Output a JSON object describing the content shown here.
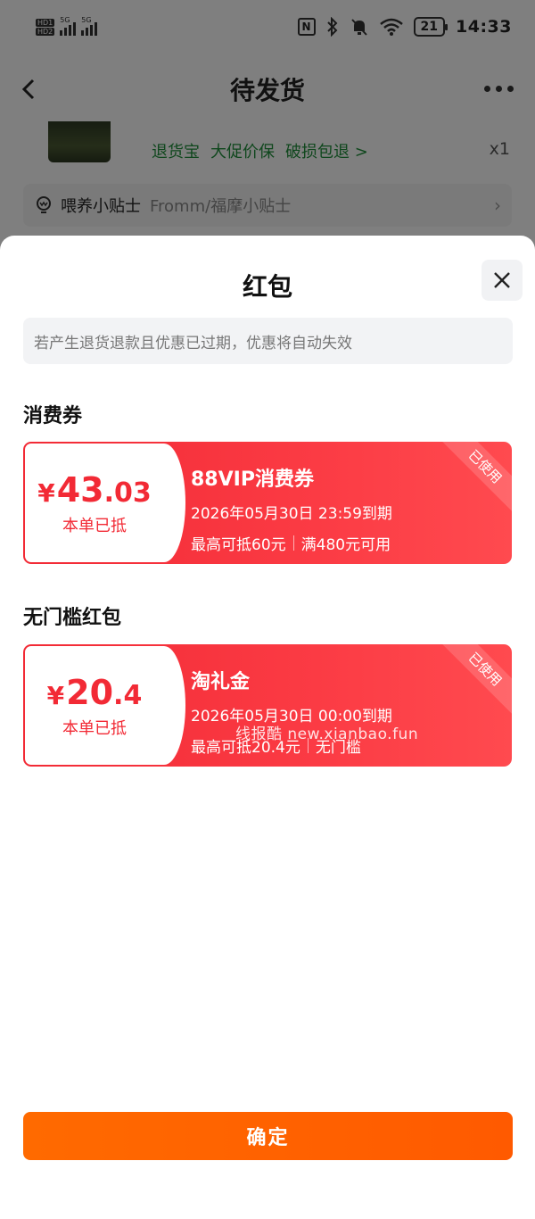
{
  "status_bar": {
    "hd1": "HD1",
    "hd2": "HD2",
    "net1": "5G",
    "net2": "5G",
    "battery": "21",
    "time": "14:33"
  },
  "nav": {
    "title": "待发货"
  },
  "product": {
    "tags": [
      "退货宝",
      "大促价保",
      "破损包退 >"
    ],
    "qty": "x1"
  },
  "tip": {
    "label": "喂养小贴士",
    "value": "Fromm/福摩小贴士"
  },
  "sheet": {
    "title": "红包",
    "notice": "若产生退货退款且优惠已过期，优惠将自动失效",
    "sections": [
      {
        "title": "消费券",
        "coupon": {
          "symbol": "¥",
          "amount_int": "43",
          "amount_dec": ".03",
          "applied": "本单已抵",
          "name": "88VIP消费券",
          "expiry": "2026年05月30日 23:59到期",
          "rule1": "最高可抵60元",
          "rule2": "满480元可用",
          "status": "已使用"
        }
      },
      {
        "title": "无门槛红包",
        "coupon": {
          "symbol": "¥",
          "amount_int": "20",
          "amount_dec": ".4",
          "applied": "本单已抵",
          "name": "淘礼金",
          "expiry": "2026年05月30日 00:00到期",
          "rule1": "最高可抵20.4元",
          "rule2": "无门槛",
          "status": "已使用"
        }
      }
    ],
    "watermark": "线报酷 new.xianbao.fun",
    "confirm": "确定"
  },
  "colors": {
    "coupon_red": "#f22a35",
    "confirm_orange": "#ff6a00",
    "service_green": "#1f8f3a"
  }
}
